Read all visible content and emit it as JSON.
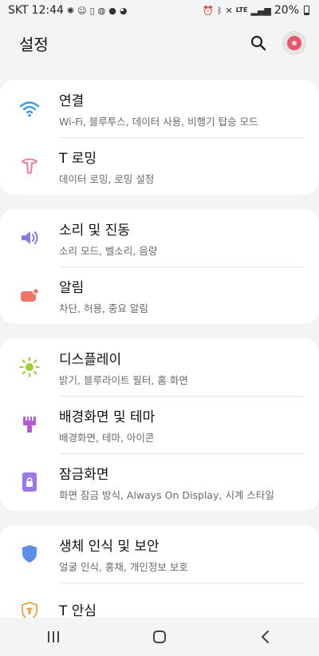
{
  "status_bar": {
    "carrier": "SKT",
    "time": "12:44",
    "network": "LTE",
    "battery": "20%",
    "left_icons": [
      "settings-gear-icon",
      "user-icon",
      "clipboard-icon",
      "talk-icon",
      "chat-bubble-icon",
      "chat-dot-icon"
    ],
    "right_icons": [
      "alarm-icon",
      "bluetooth-icon",
      "mute-icon",
      "wifi-call-icon",
      "signal-icon"
    ]
  },
  "header": {
    "title": "설정",
    "search_icon": "search-icon",
    "avatar": "profile-avatar"
  },
  "groups": [
    {
      "items": [
        {
          "title": "연결",
          "subtitle": "Wi-Fi, 블루투스, 데이터 사용, 비행기 탑승 모드",
          "icon": "wifi-icon",
          "color": "#3b9be8"
        },
        {
          "title": "T 로밍",
          "subtitle": "데이터 로밍, 로밍 설정",
          "icon": "t-roaming-icon",
          "color": "#e8808f"
        }
      ]
    },
    {
      "items": [
        {
          "title": "소리 및 진동",
          "subtitle": "소리 모드, 벨소리, 음량",
          "icon": "speaker-icon",
          "color": "#8b76e6"
        },
        {
          "title": "알림",
          "subtitle": "차단, 허용, 중요 알림",
          "icon": "notification-icon",
          "color": "#f07468"
        }
      ]
    },
    {
      "items": [
        {
          "title": "디스플레이",
          "subtitle": "밝기, 블루라이트 필터, 홈 화면",
          "icon": "brightness-icon",
          "color": "#9ccf3a"
        },
        {
          "title": "배경화면 및 테마",
          "subtitle": "배경화면, 테마, 아이콘",
          "icon": "paintbrush-icon",
          "color": "#b65ad6"
        },
        {
          "title": "잠금화면",
          "subtitle": "화면 잠금 방식, Always On Display, 시계 스타일",
          "icon": "lock-screen-icon",
          "color": "#9a78e8"
        }
      ]
    },
    {
      "items": [
        {
          "title": "생체 인식 및 보안",
          "subtitle": "얼굴 인식, 홍채, 개인정보 보호",
          "icon": "shield-icon",
          "color": "#5b8fe8"
        },
        {
          "title": "T 안심",
          "subtitle": "",
          "icon": "t-safe-icon",
          "color": "#f0a04a"
        }
      ]
    }
  ],
  "nav_bar": {
    "recent": "recent-apps-icon",
    "home": "home-icon",
    "back": "back-icon"
  }
}
